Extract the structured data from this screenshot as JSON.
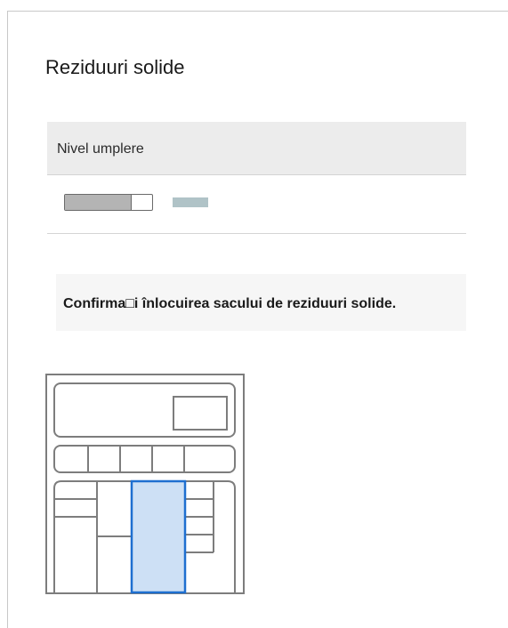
{
  "panel": {
    "title": "Reziduuri solide"
  },
  "fill_table": {
    "header": "Nivel umplere",
    "fill_level_percent": 75,
    "bar_color": "#b4b4b4",
    "status_color": "#b0c3c7"
  },
  "message": {
    "text": "Confirma□i înlocuirea sacului de reziduuri solide."
  },
  "illustration": {
    "icon": "appliance-compartment-diagram-icon",
    "highlight_color": "#cde0f5",
    "highlight_border_color": "#1e6fd0"
  }
}
